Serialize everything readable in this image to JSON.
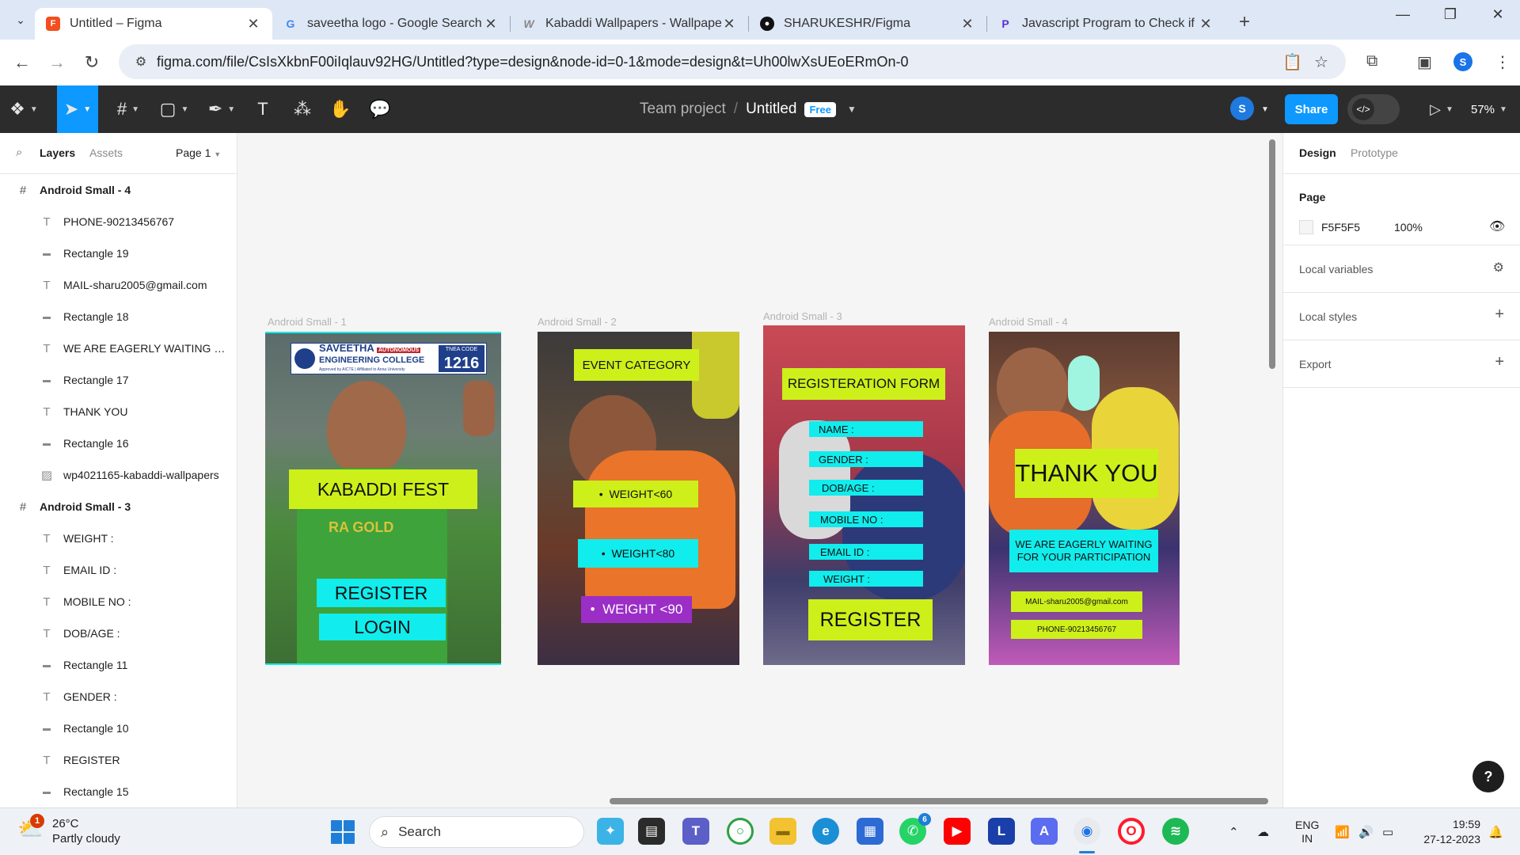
{
  "browser": {
    "tabs": [
      {
        "title": "Untitled – Figma",
        "favicon": "figma-icon",
        "active": true
      },
      {
        "title": "saveetha logo - Google Search",
        "favicon": "google-icon",
        "active": false
      },
      {
        "title": "Kabaddi Wallpapers - Wallpaper",
        "favicon": "wallpaper-site-icon",
        "active": false
      },
      {
        "title": "SHARUKESHR/Figma",
        "favicon": "github-icon",
        "active": false
      },
      {
        "title": "Javascript Program to Check if a",
        "favicon": "programiz-icon",
        "active": false
      }
    ],
    "url": "figma.com/file/CsIsXkbnF00iIqlauv92HG/Untitled?type=design&node-id=0-1&mode=design&t=Uh00lwXsUEoERmOn-0",
    "profile_initial": "S"
  },
  "figma": {
    "team": "Team project",
    "file_name": "Untitled",
    "plan_badge": "Free",
    "user_initial": "S",
    "share_label": "Share",
    "zoom": "57%"
  },
  "left_panel": {
    "tab_layers": "Layers",
    "tab_assets": "Assets",
    "page_selector": "Page 1",
    "layers": [
      {
        "name": "Android Small - 4",
        "kind": "frame"
      },
      {
        "name": "PHONE-90213456767",
        "kind": "text"
      },
      {
        "name": "Rectangle 19",
        "kind": "rect"
      },
      {
        "name": "MAIL-sharu2005@gmail.com",
        "kind": "text"
      },
      {
        "name": "Rectangle 18",
        "kind": "rect"
      },
      {
        "name": "WE ARE EAGERLY WAITING FOR YOUR PARTICIPATION",
        "kind": "text"
      },
      {
        "name": "Rectangle 17",
        "kind": "rect"
      },
      {
        "name": "THANK YOU",
        "kind": "text"
      },
      {
        "name": "Rectangle 16",
        "kind": "rect"
      },
      {
        "name": "wp4021165-kabaddi-wallpapers",
        "kind": "image"
      },
      {
        "name": "Android Small - 3",
        "kind": "frame"
      },
      {
        "name": "WEIGHT :",
        "kind": "text"
      },
      {
        "name": "EMAIL ID :",
        "kind": "text"
      },
      {
        "name": "MOBILE NO :",
        "kind": "text"
      },
      {
        "name": "DOB/AGE :",
        "kind": "text"
      },
      {
        "name": "Rectangle 11",
        "kind": "rect"
      },
      {
        "name": "GENDER :",
        "kind": "text"
      },
      {
        "name": "Rectangle 10",
        "kind": "rect"
      },
      {
        "name": "REGISTER",
        "kind": "text"
      },
      {
        "name": "Rectangle 15",
        "kind": "rect"
      }
    ]
  },
  "canvas": {
    "frames": [
      {
        "label": "Android Small - 1",
        "logo": {
          "line1": "SAVEETHA",
          "line2": "ENGINEERING COLLEGE",
          "tag": "AUTONOMOUS",
          "sub": "Approved by AICTE | Affiliated to Anna University",
          "code_label": "TNEA CODE",
          "code": "1216"
        },
        "title": "KABADDI FEST",
        "jersey_text": "RA GOLD",
        "register": "REGISTER",
        "login": "LOGIN"
      },
      {
        "label": "Android Small - 2",
        "event_category": "EVENT CATEGORY",
        "w60": "WEIGHT<60",
        "w80": "WEIGHT<80",
        "w90": "WEIGHT <90"
      },
      {
        "label": "Android Small - 3",
        "form_title": "REGISTERATION FORM",
        "name": "NAME :",
        "gender": "GENDER :",
        "dob": "DOB/AGE :",
        "mobile": "MOBILE NO :",
        "email": "EMAIL ID :",
        "weight": "WEIGHT :",
        "register": "REGISTER"
      },
      {
        "label": "Android Small - 4",
        "thank_you": "THANK YOU",
        "waiting_1": "WE ARE EAGERLY WAITING",
        "waiting_2": "FOR YOUR PARTICIPATION",
        "mail": "MAIL-sharu2005@gmail.com",
        "phone": "PHONE-90213456767"
      }
    ]
  },
  "right_panel": {
    "tab_design": "Design",
    "tab_prototype": "Prototype",
    "page_heading": "Page",
    "page_color": "F5F5F5",
    "page_opacity": "100%",
    "local_variables": "Local variables",
    "local_styles": "Local styles",
    "export": "Export",
    "help": "?"
  },
  "taskbar": {
    "weather_temp": "26°C",
    "weather_desc": "Partly cloudy",
    "weather_badge": "1",
    "search_placeholder": "Search",
    "whatsapp_badge": "6",
    "lang_line1": "ENG",
    "lang_line2": "IN",
    "time": "19:59",
    "date": "27-12-2023"
  },
  "colors": {
    "figma_blue": "#0d99ff",
    "toolbar_dark": "#2c2c2c",
    "canvas_bg": "#F5F5F5",
    "lime": "#cdf01a",
    "cyan": "#11ecec",
    "purple": "#9b2ec6"
  }
}
